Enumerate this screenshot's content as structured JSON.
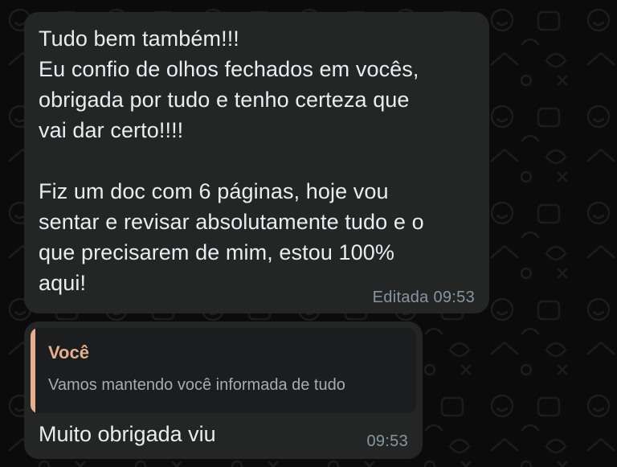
{
  "colors": {
    "background": "#0b0b0b",
    "bubble": "#242626",
    "text": "#e9edef",
    "meta": "#8696a0",
    "quote_accent": "#e5b08d",
    "quote_background": "#1b1d1e"
  },
  "messages": [
    {
      "text": "Tudo bem também!!!\nEu confio de olhos fechados em vocês,\nobrigada por tudo e tenho certeza que\nvai dar certo!!!!\n\nFiz um doc com 6 páginas, hoje vou\nsentar e revisar absolutamente tudo e o\nque precisarem de mim, estou 100%\naqui!",
      "meta": "Editada 09:53"
    },
    {
      "quote": {
        "author": "Você",
        "text": "Vamos mantendo você informada de tudo"
      },
      "text": "Muito obrigada viu",
      "meta": "09:53"
    }
  ]
}
